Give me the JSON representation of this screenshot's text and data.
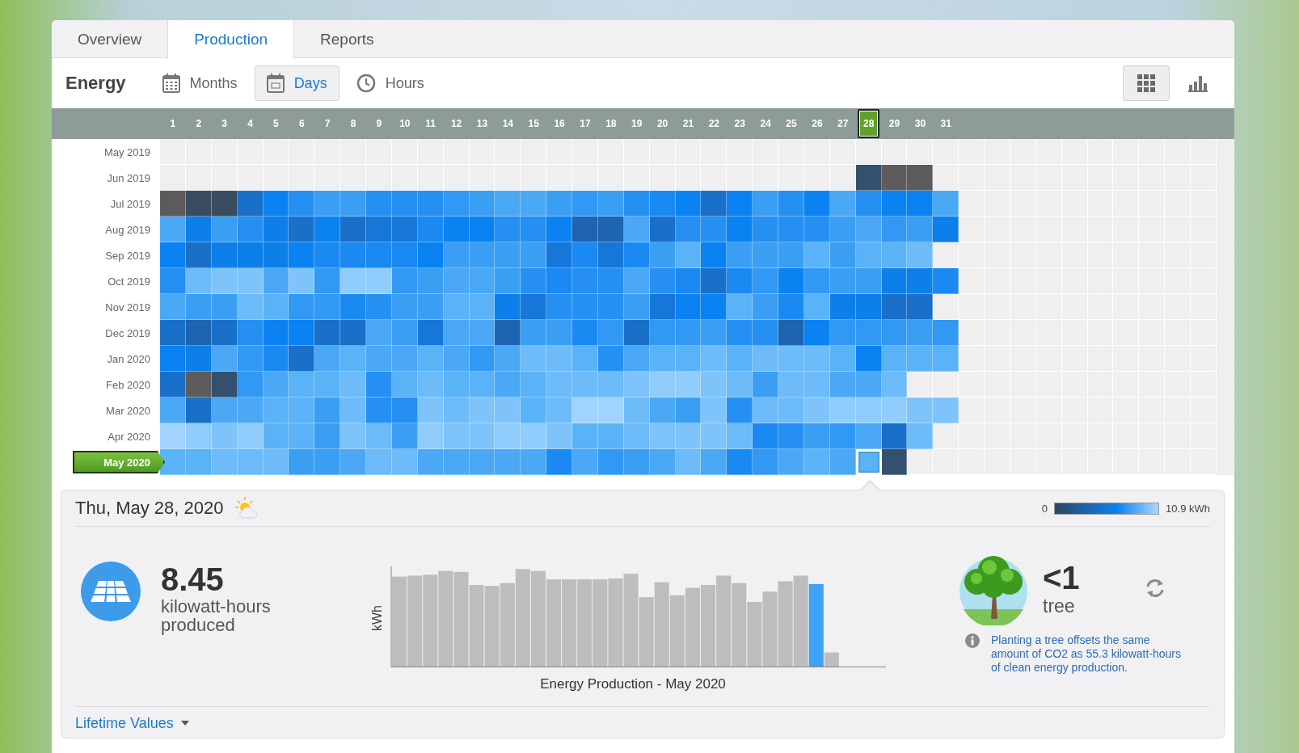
{
  "tabs": [
    {
      "label": "Overview",
      "selected": false
    },
    {
      "label": "Production",
      "selected": true
    },
    {
      "label": "Reports",
      "selected": false
    }
  ],
  "toolbar": {
    "title": "Energy",
    "ranges": [
      {
        "kind": "months",
        "label": "Months",
        "selected": false
      },
      {
        "kind": "days",
        "label": "Days",
        "selected": true
      },
      {
        "kind": "hours",
        "label": "Hours",
        "selected": false
      }
    ],
    "views": [
      {
        "kind": "grid",
        "selected": true
      },
      {
        "kind": "bars",
        "selected": false
      }
    ]
  },
  "heatmap": {
    "days": [
      {
        "label": "1",
        "selected": false
      },
      {
        "label": "2",
        "selected": false
      },
      {
        "label": "3",
        "selected": false
      },
      {
        "label": "4",
        "selected": false
      },
      {
        "label": "5",
        "selected": false
      },
      {
        "label": "6",
        "selected": false
      },
      {
        "label": "7",
        "selected": false
      },
      {
        "label": "8",
        "selected": false
      },
      {
        "label": "9",
        "selected": false
      },
      {
        "label": "10",
        "selected": false
      },
      {
        "label": "11",
        "selected": false
      },
      {
        "label": "12",
        "selected": false
      },
      {
        "label": "13",
        "selected": false
      },
      {
        "label": "14",
        "selected": false
      },
      {
        "label": "15",
        "selected": false
      },
      {
        "label": "16",
        "selected": false
      },
      {
        "label": "17",
        "selected": false
      },
      {
        "label": "18",
        "selected": false
      },
      {
        "label": "19",
        "selected": false
      },
      {
        "label": "20",
        "selected": false
      },
      {
        "label": "21",
        "selected": false
      },
      {
        "label": "22",
        "selected": false
      },
      {
        "label": "23",
        "selected": false
      },
      {
        "label": "24",
        "selected": false
      },
      {
        "label": "25",
        "selected": false
      },
      {
        "label": "26",
        "selected": false
      },
      {
        "label": "27",
        "selected": false
      },
      {
        "label": "28",
        "selected": true
      },
      {
        "label": "29",
        "selected": false
      },
      {
        "label": "30",
        "selected": false
      },
      {
        "label": "31",
        "selected": false
      }
    ],
    "rows": [
      {
        "label": "May 2019",
        "selected": false
      },
      {
        "label": "Jun 2019",
        "selected": false,
        "cells": [
          {
            "kind": "empty"
          },
          {
            "kind": "empty"
          },
          {
            "kind": "empty"
          },
          {
            "kind": "empty"
          },
          {
            "kind": "empty"
          },
          {
            "kind": "empty"
          },
          {
            "kind": "empty"
          },
          {
            "kind": "empty"
          },
          {
            "kind": "empty"
          },
          {
            "kind": "empty"
          },
          {
            "kind": "empty"
          },
          {
            "kind": "empty"
          },
          {
            "kind": "empty"
          },
          {
            "kind": "empty"
          },
          {
            "kind": "empty"
          },
          {
            "kind": "empty"
          },
          {
            "kind": "empty"
          },
          {
            "kind": "empty"
          },
          {
            "kind": "empty"
          },
          {
            "kind": "empty"
          },
          {
            "kind": "empty"
          },
          {
            "kind": "empty"
          },
          {
            "kind": "empty"
          },
          {
            "kind": "empty"
          },
          {
            "kind": "empty"
          },
          {
            "kind": "empty"
          },
          {
            "kind": "empty"
          },
          {
            "kind": "day",
            "color": "#34506e"
          },
          {
            "kind": "day",
            "color": "#5c5c5c"
          },
          {
            "kind": "day",
            "color": "#5c5c5c"
          }
        ]
      },
      {
        "label": "Jul 2019",
        "selected": false,
        "cells": [
          {
            "kind": "day",
            "color": "#5c5c5c"
          },
          {
            "kind": "day",
            "color": "#3a4d60"
          },
          {
            "kind": "day",
            "color": "#3a4d60"
          },
          {
            "kind": "day",
            "color": "#1a70c8"
          },
          {
            "kind": "day",
            "color": "#0a82f2"
          },
          {
            "kind": "day",
            "color": "#2590f2"
          },
          {
            "kind": "day",
            "color": "#3a9ff3"
          },
          {
            "kind": "day",
            "color": "#3a9ff3"
          },
          {
            "kind": "day",
            "color": "#2590f2"
          },
          {
            "kind": "day",
            "color": "#2590f2"
          },
          {
            "kind": "day",
            "color": "#2590f2"
          },
          {
            "kind": "day",
            "color": "#3198f3"
          },
          {
            "kind": "day",
            "color": "#3a9ff3"
          },
          {
            "kind": "day",
            "color": "#4aa8f5"
          },
          {
            "kind": "day",
            "color": "#4aa8f5"
          },
          {
            "kind": "day",
            "color": "#3a9ff3"
          },
          {
            "kind": "day",
            "color": "#3198f3"
          },
          {
            "kind": "day",
            "color": "#3a9ff3"
          },
          {
            "kind": "day",
            "color": "#2590f2"
          },
          {
            "kind": "day",
            "color": "#1a8af2"
          },
          {
            "kind": "day",
            "color": "#0a82f2"
          },
          {
            "kind": "day",
            "color": "#1a70c8"
          },
          {
            "kind": "day",
            "color": "#0a82f2"
          },
          {
            "kind": "day",
            "color": "#3a9ff3"
          },
          {
            "kind": "day",
            "color": "#2590f2"
          },
          {
            "kind": "day",
            "color": "#0a82f2"
          },
          {
            "kind": "day",
            "color": "#4aa8f5"
          },
          {
            "kind": "day",
            "color": "#2590f2"
          },
          {
            "kind": "day",
            "color": "#0a82f2"
          },
          {
            "kind": "day",
            "color": "#0a82f2"
          },
          {
            "kind": "day",
            "color": "#4aa8f5"
          }
        ]
      },
      {
        "label": "Aug 2019",
        "selected": false,
        "cells": [
          {
            "kind": "day",
            "color": "#4aa8f5"
          },
          {
            "kind": "day",
            "color": "#0d7fe8"
          },
          {
            "kind": "day",
            "color": "#3a9ff3"
          },
          {
            "kind": "day",
            "color": "#2590f2"
          },
          {
            "kind": "day",
            "color": "#0d7fe8"
          },
          {
            "kind": "day",
            "color": "#1a70c8"
          },
          {
            "kind": "day",
            "color": "#0a82f2"
          },
          {
            "kind": "day",
            "color": "#1a70c8"
          },
          {
            "kind": "day",
            "color": "#1677d8"
          },
          {
            "kind": "day",
            "color": "#1677d8"
          },
          {
            "kind": "day",
            "color": "#1a8af2"
          },
          {
            "kind": "day",
            "color": "#0a82f2"
          },
          {
            "kind": "day",
            "color": "#0a82f2"
          },
          {
            "kind": "day",
            "color": "#2590f2"
          },
          {
            "kind": "day",
            "color": "#2590f2"
          },
          {
            "kind": "day",
            "color": "#0a82f2"
          },
          {
            "kind": "day",
            "color": "#1e64b0"
          },
          {
            "kind": "day",
            "color": "#1e64b0"
          },
          {
            "kind": "day",
            "color": "#4aa8f5"
          },
          {
            "kind": "day",
            "color": "#1a70c8"
          },
          {
            "kind": "day",
            "color": "#2590f2"
          },
          {
            "kind": "day",
            "color": "#2590f2"
          },
          {
            "kind": "day",
            "color": "#0a82f2"
          },
          {
            "kind": "day",
            "color": "#2590f2"
          },
          {
            "kind": "day",
            "color": "#2590f2"
          },
          {
            "kind": "day",
            "color": "#2590f2"
          },
          {
            "kind": "day",
            "color": "#3a9ff3"
          },
          {
            "kind": "day",
            "color": "#4aa8f5"
          },
          {
            "kind": "day",
            "color": "#3198f3"
          },
          {
            "kind": "day",
            "color": "#3a9ff3"
          },
          {
            "kind": "day",
            "color": "#0d7fe8"
          }
        ]
      },
      {
        "label": "Sep 2019",
        "selected": false,
        "cells": [
          {
            "kind": "day",
            "color": "#0a82f2"
          },
          {
            "kind": "day",
            "color": "#1a70c8"
          },
          {
            "kind": "day",
            "color": "#0d7fe8"
          },
          {
            "kind": "day",
            "color": "#0d7fe8"
          },
          {
            "kind": "day",
            "color": "#0d7fe8"
          },
          {
            "kind": "day",
            "color": "#0a82f2"
          },
          {
            "kind": "day",
            "color": "#1a8af2"
          },
          {
            "kind": "day",
            "color": "#1a8af2"
          },
          {
            "kind": "day",
            "color": "#1a8af2"
          },
          {
            "kind": "day",
            "color": "#1a8af2"
          },
          {
            "kind": "day",
            "color": "#0a82f2"
          },
          {
            "kind": "day",
            "color": "#3a9ff3"
          },
          {
            "kind": "day",
            "color": "#3a9ff3"
          },
          {
            "kind": "day",
            "color": "#3a9ff3"
          },
          {
            "kind": "day",
            "color": "#3a9ff3"
          },
          {
            "kind": "day",
            "color": "#1677d8"
          },
          {
            "kind": "day",
            "color": "#1a8af2"
          },
          {
            "kind": "day",
            "color": "#1677d8"
          },
          {
            "kind": "day",
            "color": "#1a8af2"
          },
          {
            "kind": "day",
            "color": "#3a9ff3"
          },
          {
            "kind": "day",
            "color": "#5ab2f7"
          },
          {
            "kind": "day",
            "color": "#0a82f2"
          },
          {
            "kind": "day",
            "color": "#3a9ff3"
          },
          {
            "kind": "day",
            "color": "#3a9ff3"
          },
          {
            "kind": "day",
            "color": "#3a9ff3"
          },
          {
            "kind": "day",
            "color": "#5ab2f7"
          },
          {
            "kind": "day",
            "color": "#3a9ff3"
          },
          {
            "kind": "day",
            "color": "#5ab2f7"
          },
          {
            "kind": "day",
            "color": "#5ab2f7"
          },
          {
            "kind": "day",
            "color": "#6dbbf8"
          }
        ]
      },
      {
        "label": "Oct 2019",
        "selected": false,
        "cells": [
          {
            "kind": "day",
            "color": "#2590f2"
          },
          {
            "kind": "day",
            "color": "#6dbbf8"
          },
          {
            "kind": "day",
            "color": "#7ec4fa"
          },
          {
            "kind": "day",
            "color": "#7ec4fa"
          },
          {
            "kind": "day",
            "color": "#4aa8f5"
          },
          {
            "kind": "day",
            "color": "#7ec4fa"
          },
          {
            "kind": "day",
            "color": "#3198f3"
          },
          {
            "kind": "day",
            "color": "#90cdfc"
          },
          {
            "kind": "day",
            "color": "#90cdfc"
          },
          {
            "kind": "day",
            "color": "#3198f3"
          },
          {
            "kind": "day",
            "color": "#3a9ff3"
          },
          {
            "kind": "day",
            "color": "#4aa8f5"
          },
          {
            "kind": "day",
            "color": "#4aa8f5"
          },
          {
            "kind": "day",
            "color": "#3a9ff3"
          },
          {
            "kind": "day",
            "color": "#2590f2"
          },
          {
            "kind": "day",
            "color": "#1a8af2"
          },
          {
            "kind": "day",
            "color": "#2590f2"
          },
          {
            "kind": "day",
            "color": "#2590f2"
          },
          {
            "kind": "day",
            "color": "#4aa8f5"
          },
          {
            "kind": "day",
            "color": "#2590f2"
          },
          {
            "kind": "day",
            "color": "#1a8af2"
          },
          {
            "kind": "day",
            "color": "#1a70c8"
          },
          {
            "kind": "day",
            "color": "#1a8af2"
          },
          {
            "kind": "day",
            "color": "#3198f3"
          },
          {
            "kind": "day",
            "color": "#0a82f2"
          },
          {
            "kind": "day",
            "color": "#3198f3"
          },
          {
            "kind": "day",
            "color": "#3a9ff3"
          },
          {
            "kind": "day",
            "color": "#3a9ff3"
          },
          {
            "kind": "day",
            "color": "#0d7fe8"
          },
          {
            "kind": "day",
            "color": "#0d7fe8"
          },
          {
            "kind": "day",
            "color": "#1a8af2"
          }
        ]
      },
      {
        "label": "Nov 2019",
        "selected": false,
        "cells": [
          {
            "kind": "day",
            "color": "#4aa8f5"
          },
          {
            "kind": "day",
            "color": "#3a9ff3"
          },
          {
            "kind": "day",
            "color": "#3a9ff3"
          },
          {
            "kind": "day",
            "color": "#6dbbf8"
          },
          {
            "kind": "day",
            "color": "#5ab2f7"
          },
          {
            "kind": "day",
            "color": "#3198f3"
          },
          {
            "kind": "day",
            "color": "#3198f3"
          },
          {
            "kind": "day",
            "color": "#1a8af2"
          },
          {
            "kind": "day",
            "color": "#2590f2"
          },
          {
            "kind": "day",
            "color": "#3a9ff3"
          },
          {
            "kind": "day",
            "color": "#3a9ff3"
          },
          {
            "kind": "day",
            "color": "#5ab2f7"
          },
          {
            "kind": "day",
            "color": "#5ab2f7"
          },
          {
            "kind": "day",
            "color": "#0d7fe8"
          },
          {
            "kind": "day",
            "color": "#1677d8"
          },
          {
            "kind": "day",
            "color": "#2590f2"
          },
          {
            "kind": "day",
            "color": "#2590f2"
          },
          {
            "kind": "day",
            "color": "#2590f2"
          },
          {
            "kind": "day",
            "color": "#3a9ff3"
          },
          {
            "kind": "day",
            "color": "#1677d8"
          },
          {
            "kind": "day",
            "color": "#0a82f2"
          },
          {
            "kind": "day",
            "color": "#0a82f2"
          },
          {
            "kind": "day",
            "color": "#5ab2f7"
          },
          {
            "kind": "day",
            "color": "#3a9ff3"
          },
          {
            "kind": "day",
            "color": "#1a8af2"
          },
          {
            "kind": "day",
            "color": "#5ab2f7"
          },
          {
            "kind": "day",
            "color": "#0d7fe8"
          },
          {
            "kind": "day",
            "color": "#0d7fe8"
          },
          {
            "kind": "day",
            "color": "#1a70c8"
          },
          {
            "kind": "day",
            "color": "#1a70c8"
          }
        ]
      },
      {
        "label": "Dec 2019",
        "selected": false,
        "cells": [
          {
            "kind": "day",
            "color": "#1a70c8"
          },
          {
            "kind": "day",
            "color": "#1e64b0"
          },
          {
            "kind": "day",
            "color": "#1a70c8"
          },
          {
            "kind": "day",
            "color": "#2590f2"
          },
          {
            "kind": "day",
            "color": "#0a82f2"
          },
          {
            "kind": "day",
            "color": "#0a82f2"
          },
          {
            "kind": "day",
            "color": "#1a70c8"
          },
          {
            "kind": "day",
            "color": "#1a70c8"
          },
          {
            "kind": "day",
            "color": "#4aa8f5"
          },
          {
            "kind": "day",
            "color": "#3a9ff3"
          },
          {
            "kind": "day",
            "color": "#1677d8"
          },
          {
            "kind": "day",
            "color": "#4aa8f5"
          },
          {
            "kind": "day",
            "color": "#4aa8f5"
          },
          {
            "kind": "day",
            "color": "#1e64b0"
          },
          {
            "kind": "day",
            "color": "#3a9ff3"
          },
          {
            "kind": "day",
            "color": "#3a9ff3"
          },
          {
            "kind": "day",
            "color": "#1a8af2"
          },
          {
            "kind": "day",
            "color": "#3198f3"
          },
          {
            "kind": "day",
            "color": "#1a70c8"
          },
          {
            "kind": "day",
            "color": "#3198f3"
          },
          {
            "kind": "day",
            "color": "#3198f3"
          },
          {
            "kind": "day",
            "color": "#3a9ff3"
          },
          {
            "kind": "day",
            "color": "#2590f2"
          },
          {
            "kind": "day",
            "color": "#2590f2"
          },
          {
            "kind": "day",
            "color": "#1e64b0"
          },
          {
            "kind": "day",
            "color": "#0a82f2"
          },
          {
            "kind": "day",
            "color": "#3198f3"
          },
          {
            "kind": "day",
            "color": "#3198f3"
          },
          {
            "kind": "day",
            "color": "#3198f3"
          },
          {
            "kind": "day",
            "color": "#3a9ff3"
          },
          {
            "kind": "day",
            "color": "#3198f3"
          }
        ]
      },
      {
        "label": "Jan 2020",
        "selected": false,
        "cells": [
          {
            "kind": "day",
            "color": "#0a82f2"
          },
          {
            "kind": "day",
            "color": "#0d7fe8"
          },
          {
            "kind": "day",
            "color": "#4aa8f5"
          },
          {
            "kind": "day",
            "color": "#3198f3"
          },
          {
            "kind": "day",
            "color": "#1a8af2"
          },
          {
            "kind": "day",
            "color": "#1a70c8"
          },
          {
            "kind": "day",
            "color": "#4aa8f5"
          },
          {
            "kind": "day",
            "color": "#5ab2f7"
          },
          {
            "kind": "day",
            "color": "#4aa8f5"
          },
          {
            "kind": "day",
            "color": "#4aa8f5"
          },
          {
            "kind": "day",
            "color": "#5ab2f7"
          },
          {
            "kind": "day",
            "color": "#4aa8f5"
          },
          {
            "kind": "day",
            "color": "#3198f3"
          },
          {
            "kind": "day",
            "color": "#4aa8f5"
          },
          {
            "kind": "day",
            "color": "#6dbbf8"
          },
          {
            "kind": "day",
            "color": "#6dbbf8"
          },
          {
            "kind": "day",
            "color": "#5ab2f7"
          },
          {
            "kind": "day",
            "color": "#2590f2"
          },
          {
            "kind": "day",
            "color": "#4aa8f5"
          },
          {
            "kind": "day",
            "color": "#5ab2f7"
          },
          {
            "kind": "day",
            "color": "#5ab2f7"
          },
          {
            "kind": "day",
            "color": "#6dbbf8"
          },
          {
            "kind": "day",
            "color": "#5ab2f7"
          },
          {
            "kind": "day",
            "color": "#6dbbf8"
          },
          {
            "kind": "day",
            "color": "#6dbbf8"
          },
          {
            "kind": "day",
            "color": "#6dbbf8"
          },
          {
            "kind": "day",
            "color": "#5ab2f7"
          },
          {
            "kind": "day",
            "color": "#0a82f2"
          },
          {
            "kind": "day",
            "color": "#5ab2f7"
          },
          {
            "kind": "day",
            "color": "#5ab2f7"
          },
          {
            "kind": "day",
            "color": "#5ab2f7"
          }
        ]
      },
      {
        "label": "Feb 2020",
        "selected": false,
        "cells": [
          {
            "kind": "day",
            "color": "#1a70c8"
          },
          {
            "kind": "day",
            "color": "#5c5c5c"
          },
          {
            "kind": "day",
            "color": "#34506e"
          },
          {
            "kind": "day",
            "color": "#3198f3"
          },
          {
            "kind": "day",
            "color": "#4aa8f5"
          },
          {
            "kind": "day",
            "color": "#5ab2f7"
          },
          {
            "kind": "day",
            "color": "#5ab2f7"
          },
          {
            "kind": "day",
            "color": "#6dbbf8"
          },
          {
            "kind": "day",
            "color": "#2590f2"
          },
          {
            "kind": "day",
            "color": "#5ab2f7"
          },
          {
            "kind": "day",
            "color": "#6dbbf8"
          },
          {
            "kind": "day",
            "color": "#5ab2f7"
          },
          {
            "kind": "day",
            "color": "#5ab2f7"
          },
          {
            "kind": "day",
            "color": "#4aa8f5"
          },
          {
            "kind": "day",
            "color": "#5ab2f7"
          },
          {
            "kind": "day",
            "color": "#6dbbf8"
          },
          {
            "kind": "day",
            "color": "#6dbbf8"
          },
          {
            "kind": "day",
            "color": "#6dbbf8"
          },
          {
            "kind": "day",
            "color": "#7ec4fa"
          },
          {
            "kind": "day",
            "color": "#90cdfc"
          },
          {
            "kind": "day",
            "color": "#90cdfc"
          },
          {
            "kind": "day",
            "color": "#7ec4fa"
          },
          {
            "kind": "day",
            "color": "#6dbbf8"
          },
          {
            "kind": "day",
            "color": "#3a9ff3"
          },
          {
            "kind": "day",
            "color": "#6dbbf8"
          },
          {
            "kind": "day",
            "color": "#6dbbf8"
          },
          {
            "kind": "day",
            "color": "#4aa8f5"
          },
          {
            "kind": "day",
            "color": "#4aa8f5"
          },
          {
            "kind": "day",
            "color": "#6dbbf8"
          }
        ]
      },
      {
        "label": "Mar 2020",
        "selected": false,
        "cells": [
          {
            "kind": "day",
            "color": "#4aa8f5"
          },
          {
            "kind": "day",
            "color": "#1a70c8"
          },
          {
            "kind": "day",
            "color": "#4aa8f5"
          },
          {
            "kind": "day",
            "color": "#4aa8f5"
          },
          {
            "kind": "day",
            "color": "#5ab2f7"
          },
          {
            "kind": "day",
            "color": "#5ab2f7"
          },
          {
            "kind": "day",
            "color": "#3a9ff3"
          },
          {
            "kind": "day",
            "color": "#6dbbf8"
          },
          {
            "kind": "day",
            "color": "#2590f2"
          },
          {
            "kind": "day",
            "color": "#2590f2"
          },
          {
            "kind": "day",
            "color": "#7ec4fa"
          },
          {
            "kind": "day",
            "color": "#6dbbf8"
          },
          {
            "kind": "day",
            "color": "#7ec4fa"
          },
          {
            "kind": "day",
            "color": "#7ec4fa"
          },
          {
            "kind": "day",
            "color": "#5ab2f7"
          },
          {
            "kind": "day",
            "color": "#6dbbf8"
          },
          {
            "kind": "day",
            "color": "#a0d4ff"
          },
          {
            "kind": "day",
            "color": "#a0d4ff"
          },
          {
            "kind": "day",
            "color": "#6dbbf8"
          },
          {
            "kind": "day",
            "color": "#4aa8f5"
          },
          {
            "kind": "day",
            "color": "#3a9ff3"
          },
          {
            "kind": "day",
            "color": "#7ec4fa"
          },
          {
            "kind": "day",
            "color": "#2590f2"
          },
          {
            "kind": "day",
            "color": "#6dbbf8"
          },
          {
            "kind": "day",
            "color": "#6dbbf8"
          },
          {
            "kind": "day",
            "color": "#7ec4fa"
          },
          {
            "kind": "day",
            "color": "#90cdfc"
          },
          {
            "kind": "day",
            "color": "#90cdfc"
          },
          {
            "kind": "day",
            "color": "#90cdfc"
          },
          {
            "kind": "day",
            "color": "#7ec4fa"
          },
          {
            "kind": "day",
            "color": "#7ec4fa"
          }
        ]
      },
      {
        "label": "Apr 2020",
        "selected": false,
        "cells": [
          {
            "kind": "day",
            "color": "#a0d4ff"
          },
          {
            "kind": "day",
            "color": "#90cdfc"
          },
          {
            "kind": "day",
            "color": "#7ec4fa"
          },
          {
            "kind": "day",
            "color": "#90cdfc"
          },
          {
            "kind": "day",
            "color": "#5ab2f7"
          },
          {
            "kind": "day",
            "color": "#5ab2f7"
          },
          {
            "kind": "day",
            "color": "#3a9ff3"
          },
          {
            "kind": "day",
            "color": "#7ec4fa"
          },
          {
            "kind": "day",
            "color": "#6dbbf8"
          },
          {
            "kind": "day",
            "color": "#3a9ff3"
          },
          {
            "kind": "day",
            "color": "#90cdfc"
          },
          {
            "kind": "day",
            "color": "#7ec4fa"
          },
          {
            "kind": "day",
            "color": "#7ec4fa"
          },
          {
            "kind": "day",
            "color": "#90cdfc"
          },
          {
            "kind": "day",
            "color": "#90cdfc"
          },
          {
            "kind": "day",
            "color": "#7ec4fa"
          },
          {
            "kind": "day",
            "color": "#5ab2f7"
          },
          {
            "kind": "day",
            "color": "#5ab2f7"
          },
          {
            "kind": "day",
            "color": "#6dbbf8"
          },
          {
            "kind": "day",
            "color": "#7ec4fa"
          },
          {
            "kind": "day",
            "color": "#7ec4fa"
          },
          {
            "kind": "day",
            "color": "#7ec4fa"
          },
          {
            "kind": "day",
            "color": "#6dbbf8"
          },
          {
            "kind": "day",
            "color": "#1a8af2"
          },
          {
            "kind": "day",
            "color": "#2590f2"
          },
          {
            "kind": "day",
            "color": "#3a9ff3"
          },
          {
            "kind": "day",
            "color": "#3198f3"
          },
          {
            "kind": "day",
            "color": "#4aa8f5"
          },
          {
            "kind": "day",
            "color": "#1a70c8"
          },
          {
            "kind": "day",
            "color": "#6dbbf8"
          }
        ]
      },
      {
        "label": "May 2020",
        "selected": true,
        "cells": [
          {
            "kind": "day",
            "color": "#5ab2f7"
          },
          {
            "kind": "day",
            "color": "#5ab2f7"
          },
          {
            "kind": "day",
            "color": "#6dbbf8"
          },
          {
            "kind": "day",
            "color": "#6dbbf8"
          },
          {
            "kind": "day",
            "color": "#6dbbf8"
          },
          {
            "kind": "day",
            "color": "#3a9ff3"
          },
          {
            "kind": "day",
            "color": "#3a9ff3"
          },
          {
            "kind": "day",
            "color": "#4aa8f5"
          },
          {
            "kind": "day",
            "color": "#6dbbf8"
          },
          {
            "kind": "day",
            "color": "#6dbbf8"
          },
          {
            "kind": "day",
            "color": "#4aa8f5"
          },
          {
            "kind": "day",
            "color": "#4aa8f5"
          },
          {
            "kind": "day",
            "color": "#4aa8f5"
          },
          {
            "kind": "day",
            "color": "#4aa8f5"
          },
          {
            "kind": "day",
            "color": "#4aa8f5"
          },
          {
            "kind": "day",
            "color": "#1a8af2"
          },
          {
            "kind": "day",
            "color": "#4aa8f5"
          },
          {
            "kind": "day",
            "color": "#3198f3"
          },
          {
            "kind": "day",
            "color": "#3a9ff3"
          },
          {
            "kind": "day",
            "color": "#4aa8f5"
          },
          {
            "kind": "day",
            "color": "#6dbbf8"
          },
          {
            "kind": "day",
            "color": "#4aa8f5"
          },
          {
            "kind": "day",
            "color": "#1a8af2"
          },
          {
            "kind": "day",
            "color": "#3198f3"
          },
          {
            "kind": "day",
            "color": "#4aa8f5"
          },
          {
            "kind": "day",
            "color": "#5ab2f7"
          },
          {
            "kind": "day",
            "color": "#4aa8f5"
          },
          {
            "kind": "day",
            "color": "#5ab2f7"
          },
          {
            "kind": "day",
            "color": "#34506e"
          }
        ]
      }
    ]
  },
  "detail": {
    "date": "Thu, May 28, 2020",
    "legend": {
      "min": "0",
      "max": "10.9 kWh"
    },
    "production": {
      "value": "8.45",
      "unit": "kilowatt-hours produced"
    },
    "chart": {
      "ylabel": "kWh",
      "title": "Energy Production - May 2020"
    },
    "trees": {
      "value": "<1",
      "unit": "tree",
      "note": "Planting a tree offsets the same amount of CO2 as 55.3 kilowatt-hours of clean energy production."
    },
    "lifetime_link": "Lifetime Values"
  }
}
